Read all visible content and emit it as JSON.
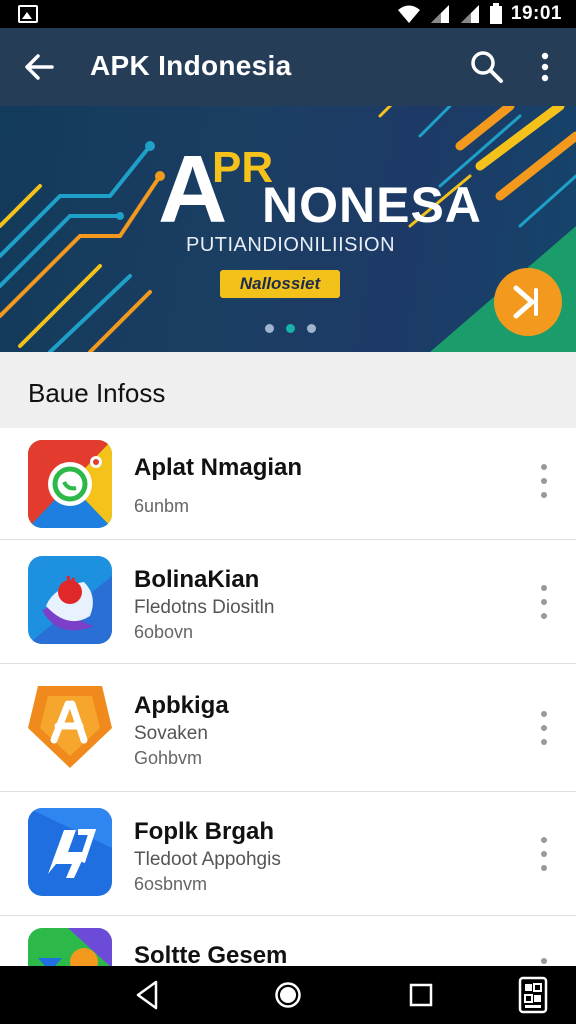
{
  "status_bar": {
    "time": "19:01"
  },
  "app_bar": {
    "title": "APK Indonesia",
    "back_icon": "arrow-left-icon",
    "search_icon": "search-icon",
    "more_icon": "more-vert-icon"
  },
  "banner": {
    "line_a": "A",
    "line_pr": "PR",
    "line_nonesa": "NONESA",
    "subtitle": "PUTIANDIONILIISION",
    "pill_label": "Nallossiet",
    "pagination": {
      "count": 3,
      "active_index": 1
    },
    "next_icon": "chevron-right-icon",
    "colors": {
      "accent_yellow": "#f5c21b",
      "accent_orange": "#f39a1e",
      "accent_teal": "#17b3a8"
    }
  },
  "section": {
    "title": "Baue Infoss"
  },
  "apps": [
    {
      "name": "Aplat Nmagian",
      "desc": "",
      "meta": "6unbm",
      "icon": "chat-bubble-icon"
    },
    {
      "name": "BolinaKian",
      "desc": "Fledotns Diositln",
      "meta": "6obovn",
      "icon": "red-circle-app-icon"
    },
    {
      "name": "Apbkiga",
      "desc": "Sovaken",
      "meta": "Gohbvm",
      "icon": "orange-shield-icon"
    },
    {
      "name": "Foplk Brgah",
      "desc": "Tledoot Appohgis",
      "meta": "6osbnvm",
      "icon": "lightning-bolt-icon"
    },
    {
      "name": "Soltte Gesem",
      "desc": "",
      "meta": "",
      "icon": "green-tile-icon"
    }
  ],
  "nav_bar": {
    "back_icon": "nav-back-icon",
    "home_icon": "nav-home-icon",
    "recents_icon": "nav-recents-icon",
    "extra_icon": "qr-code-icon"
  }
}
